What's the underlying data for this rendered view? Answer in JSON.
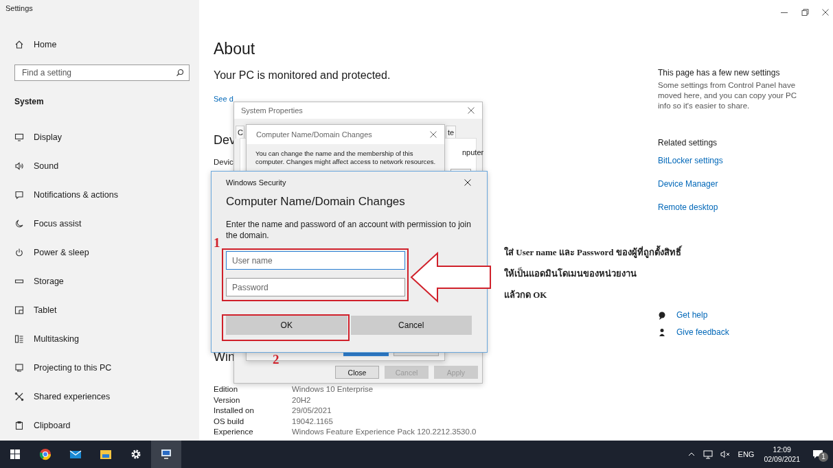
{
  "window": {
    "title": "Settings"
  },
  "sidebar": {
    "home": "Home",
    "search": {
      "placeholder": "Find a setting"
    },
    "section": "System",
    "items": [
      {
        "label": "Display"
      },
      {
        "label": "Sound"
      },
      {
        "label": "Notifications & actions"
      },
      {
        "label": "Focus assist"
      },
      {
        "label": "Power & sleep"
      },
      {
        "label": "Storage"
      },
      {
        "label": "Tablet"
      },
      {
        "label": "Multitasking"
      },
      {
        "label": "Projecting to this PC"
      },
      {
        "label": "Shared experiences"
      },
      {
        "label": "Clipboard"
      }
    ]
  },
  "main": {
    "title": "About",
    "security_heading": "Your PC is monitored and protected.",
    "security_link": "See d",
    "device_heading": "Dev",
    "device_row_label": "Devic",
    "windows_heading": "Win",
    "specs": [
      {
        "label": "Edition",
        "value": "Windows 10 Enterprise"
      },
      {
        "label": "Version",
        "value": "20H2"
      },
      {
        "label": "Installed on",
        "value": "29/05/2021"
      },
      {
        "label": "OS build",
        "value": "19042.1165"
      },
      {
        "label": "Experience",
        "value": "Windows Feature Experience Pack 120.2212.3530.0"
      }
    ]
  },
  "right_panel": {
    "new_settings_title": "This page has a few new settings",
    "new_settings_text": "Some settings from Control Panel have moved here, and you can copy your PC info so it's easier to share.",
    "related_title": "Related settings",
    "related_links": [
      "BitLocker settings",
      "Device Manager",
      "Remote desktop"
    ],
    "help_links": [
      "Get help",
      "Give feedback"
    ]
  },
  "system_properties": {
    "title": "System Properties",
    "tab_fragments": [
      "C",
      "te"
    ],
    "text_fragment": "nputer",
    "buttons": [
      {
        "label": "Close",
        "disabled": false
      },
      {
        "label": "Cancel",
        "disabled": true
      },
      {
        "label": "Apply",
        "disabled": true
      }
    ]
  },
  "name_dialog": {
    "title": "Computer Name/Domain Changes",
    "text": "You can change the name and the membership of this computer. Changes might affect access to network resources."
  },
  "security_dialog": {
    "title": "Windows Security",
    "heading": "Computer Name/Domain Changes",
    "text": "Enter the name and password of an account with permission to join the domain.",
    "fields": [
      {
        "placeholder": "User name",
        "focused": true
      },
      {
        "placeholder": "Password",
        "focused": false
      }
    ],
    "buttons": [
      "OK",
      "Cancel"
    ]
  },
  "annotations": {
    "markers": [
      "1",
      "2"
    ],
    "note_lines": [
      "ใส่ User name และ Password ของผู้ที่ถูกตั้งสิทธิ์",
      "ให้เป็นแอดมินโดเมนของหน่วยงาน",
      "แล้วกด OK"
    ]
  },
  "taskbar": {
    "apps": [
      {
        "selected": false
      },
      {
        "selected": false
      },
      {
        "selected": false
      },
      {
        "selected": false
      },
      {
        "selected": false
      },
      {
        "selected": true
      }
    ],
    "tray": {
      "language": "ENG",
      "time": "12:09",
      "date": "02/09/2021",
      "notifications": "1"
    }
  }
}
